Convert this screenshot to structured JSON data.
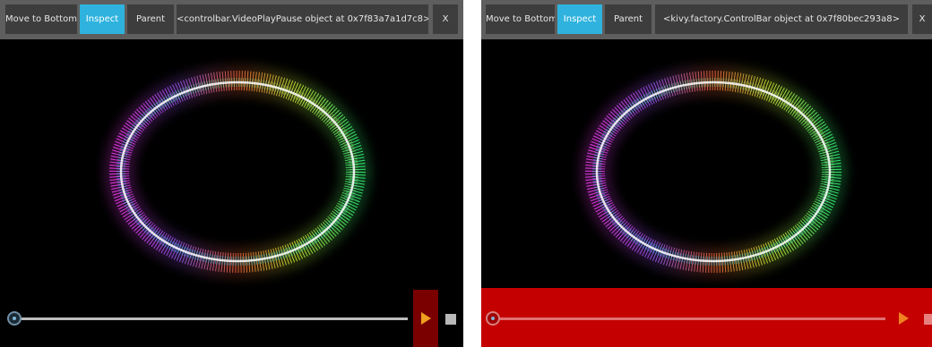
{
  "left_panel": {
    "toolbar": {
      "move_to_bottom_label": "Move to Bottom",
      "inspect_label": "Inspect",
      "parent_label": "Parent",
      "selected_widget_label": "<controlbar.VideoPlayPause object at 0x7f83a7a1d7c8>",
      "close_label": "X"
    },
    "video_controls": {
      "highlighted_widget": "play-pause-button",
      "highlight_color": "#7a0000"
    }
  },
  "right_panel": {
    "toolbar": {
      "move_to_bottom_label": "Move to Bottom",
      "inspect_label": "Inspect",
      "parent_label": "Parent",
      "selected_widget_label": "<kivy.factory.ControlBar object at 0x7f80bec293a8>",
      "close_label": "X"
    },
    "video_controls": {
      "highlighted_widget": "control-bar",
      "highlight_color": "#c40000"
    }
  },
  "colors": {
    "toolbar_bg": "#5e5e5e",
    "button_bg": "#3d3d3d",
    "active_button_bg": "#2fb3de",
    "video_bg": "#000000",
    "play_icon": "#f0a020"
  },
  "icons": [
    "play-icon",
    "stop-icon",
    "seek-knob-icon"
  ]
}
